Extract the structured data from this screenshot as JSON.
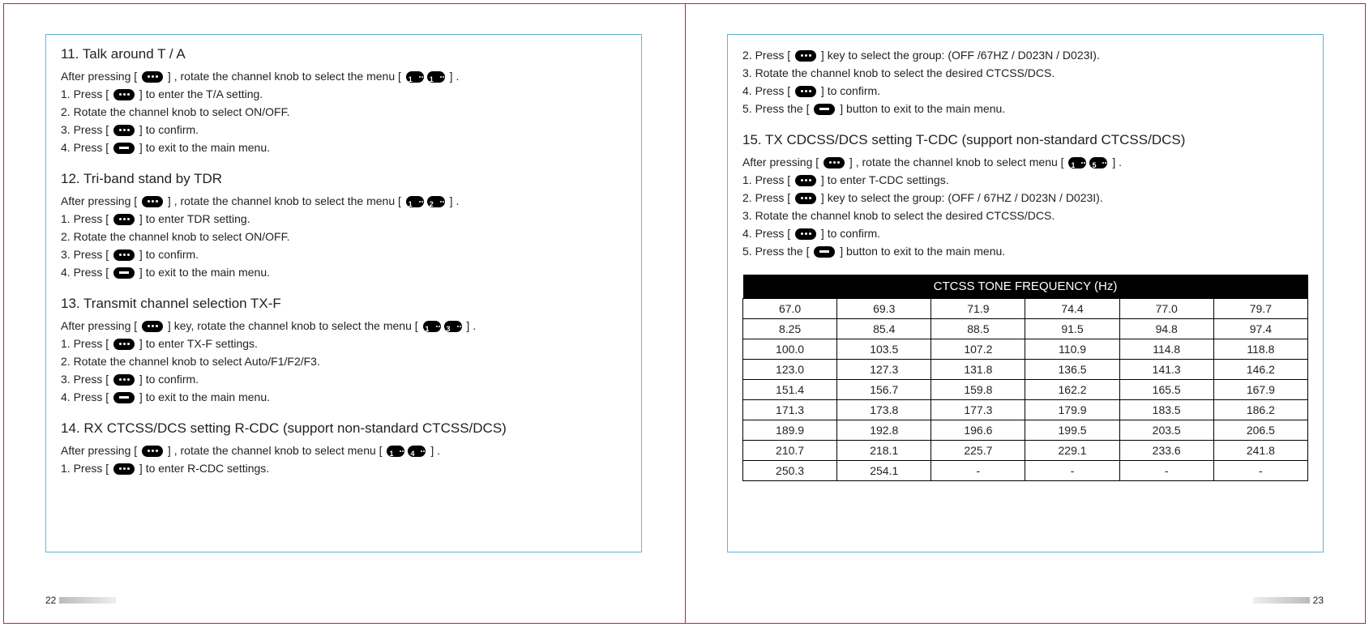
{
  "left": {
    "sections": [
      {
        "title": "11. Talk around T / A",
        "intro_pre": "After pressing [ ",
        "intro_mid": " ] , rotate the channel knob to select the menu [ ",
        "intro_post": " ] .",
        "menu_digits": [
          "1",
          "1"
        ],
        "steps": [
          {
            "pre": "1. Press [ ",
            "icon": "menu",
            "post": " ] to enter the T/A setting."
          },
          {
            "text": "2. Rotate the channel knob to select ON/OFF."
          },
          {
            "pre": "3. Press [ ",
            "icon": "menu",
            "post": " ] to confirm."
          },
          {
            "pre": "4. Press [ ",
            "icon": "exit",
            "post": " ] to exit to the main menu."
          }
        ]
      },
      {
        "title": "12. Tri-band stand by TDR",
        "intro_pre": "After pressing [ ",
        "intro_mid": " ] , rotate the channel knob to select the menu [ ",
        "intro_post": " ] .",
        "menu_digits": [
          "1",
          "2"
        ],
        "steps": [
          {
            "pre": "1. Press [ ",
            "icon": "menu",
            "post": " ]  to enter TDR setting."
          },
          {
            "text": "2. Rotate the channel knob to select ON/OFF."
          },
          {
            "pre": "3. Press [ ",
            "icon": "menu",
            "post": " ] to confirm."
          },
          {
            "pre": "4. Press [ ",
            "icon": "exit",
            "post": " ] to exit to the main menu."
          }
        ]
      },
      {
        "title": "13. Transmit channel selection TX-F",
        "intro_pre": "After pressing [ ",
        "intro_mid": " ] key, rotate the channel knob to select the menu [ ",
        "intro_post": " ] .",
        "menu_digits": [
          "1",
          "3"
        ],
        "steps": [
          {
            "pre": "1. Press [ ",
            "icon": "menu",
            "post": " ] to enter TX-F settings."
          },
          {
            "text": "2. Rotate the channel knob to select Auto/F1/F2/F3."
          },
          {
            "pre": "3. Press [ ",
            "icon": "menu",
            "post": " ] to confirm."
          },
          {
            "pre": "4. Press [ ",
            "icon": "exit",
            "post": " ] to exit to the main menu."
          }
        ]
      },
      {
        "title": "14. RX CTCSS/DCS setting R-CDC (support non-standard CTCSS/DCS)",
        "intro_pre": "After pressing [ ",
        "intro_mid": " ] , rotate the channel knob to select menu [ ",
        "intro_post": " ] .",
        "menu_digits": [
          "1",
          "4"
        ],
        "steps": [
          {
            "pre": "1. Press [ ",
            "icon": "menu",
            "post": " ] to enter R-CDC settings."
          }
        ]
      }
    ],
    "page_num": "22"
  },
  "right": {
    "cont_steps": [
      {
        "pre": "2. Press [ ",
        "icon": "menu",
        "post": " ] key to select the group: (OFF /67HZ / D023N / D023I)."
      },
      {
        "text": "3. Rotate the channel knob to select the desired CTCSS/DCS."
      },
      {
        "pre": "4. Press [ ",
        "icon": "menu",
        "post": " ] to confirm."
      },
      {
        "pre": "5. Press the [ ",
        "icon": "exit",
        "post": " ] button to exit to the main menu."
      }
    ],
    "section15": {
      "title": "15. TX CDCSS/DCS setting T-CDC (support non-standard CTCSS/DCS)",
      "intro_pre": "After pressing [ ",
      "intro_mid": " ] , rotate the channel knob to select menu [ ",
      "intro_post": " ] .",
      "menu_digits": [
        "1",
        "5"
      ],
      "steps": [
        {
          "pre": "1. Press [ ",
          "icon": "menu",
          "post": " ] to enter T-CDC settings."
        },
        {
          "pre": "2. Press [ ",
          "icon": "menu",
          "post": " ] key to select the group: (OFF / 67HZ / D023N / D023I)."
        },
        {
          "text": "3. Rotate the channel knob to select the desired CTCSS/DCS."
        },
        {
          "pre": "4. Press [ ",
          "icon": "menu",
          "post": " ] to confirm."
        },
        {
          "pre": "5. Press the [ ",
          "icon": "exit",
          "post": " ] button to exit to the main menu."
        }
      ]
    },
    "table": {
      "header": "CTCSS TONE FREQUENCY (Hz)",
      "rows": [
        [
          "67.0",
          "69.3",
          "71.9",
          "74.4",
          "77.0",
          "79.7"
        ],
        [
          "8.25",
          "85.4",
          "88.5",
          "91.5",
          "94.8",
          "97.4"
        ],
        [
          "100.0",
          "103.5",
          "107.2",
          "110.9",
          "114.8",
          "118.8"
        ],
        [
          "123.0",
          "127.3",
          "131.8",
          "136.5",
          "141.3",
          "146.2"
        ],
        [
          "151.4",
          "156.7",
          "159.8",
          "162.2",
          "165.5",
          "167.9"
        ],
        [
          "171.3",
          "173.8",
          "177.3",
          "179.9",
          "183.5",
          "186.2"
        ],
        [
          "189.9",
          "192.8",
          "196.6",
          "199.5",
          "203.5",
          "206.5"
        ],
        [
          "210.7",
          "218.1",
          "225.7",
          "229.1",
          "233.6",
          "241.8"
        ],
        [
          "250.3",
          "254.1",
          "-",
          "-",
          "-",
          "-"
        ]
      ]
    },
    "page_num": "23"
  }
}
